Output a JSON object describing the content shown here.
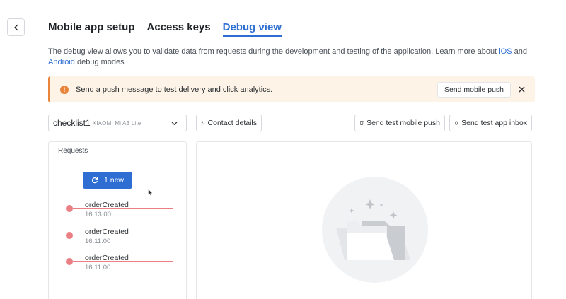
{
  "tabs": [
    {
      "label": "Mobile app setup",
      "active": false
    },
    {
      "label": "Access keys",
      "active": false
    },
    {
      "label": "Debug view",
      "active": true
    }
  ],
  "description": {
    "text1": "The debug view allows you to validate data from requests during the development and testing of the application. Learn more about ",
    "link_ios": "iOS",
    "text2": " and ",
    "link_android": "Android",
    "text3": " debug modes"
  },
  "banner": {
    "icon": "exclamation-icon",
    "text": "Send a push message to test delivery and click analytics.",
    "button_label": "Send mobile push"
  },
  "device_select": {
    "name": "checklist1",
    "model": "XIAOMI Mi A3 Lite"
  },
  "toolbar": {
    "contact_details": "Contact details",
    "send_test_push": "Send test mobile push",
    "send_test_inbox": "Send test app inbox"
  },
  "requests": {
    "header": "Requests",
    "new_button": "1 new",
    "items": [
      {
        "name": "orderCreated",
        "time": "16:13:00"
      },
      {
        "name": "orderCreated",
        "time": "16:11:00"
      },
      {
        "name": "orderCreated",
        "time": "16:11:00"
      }
    ]
  },
  "colors": {
    "accent": "#2f6fd1",
    "warning": "#e8843c",
    "error_dot": "#ea7f84"
  }
}
